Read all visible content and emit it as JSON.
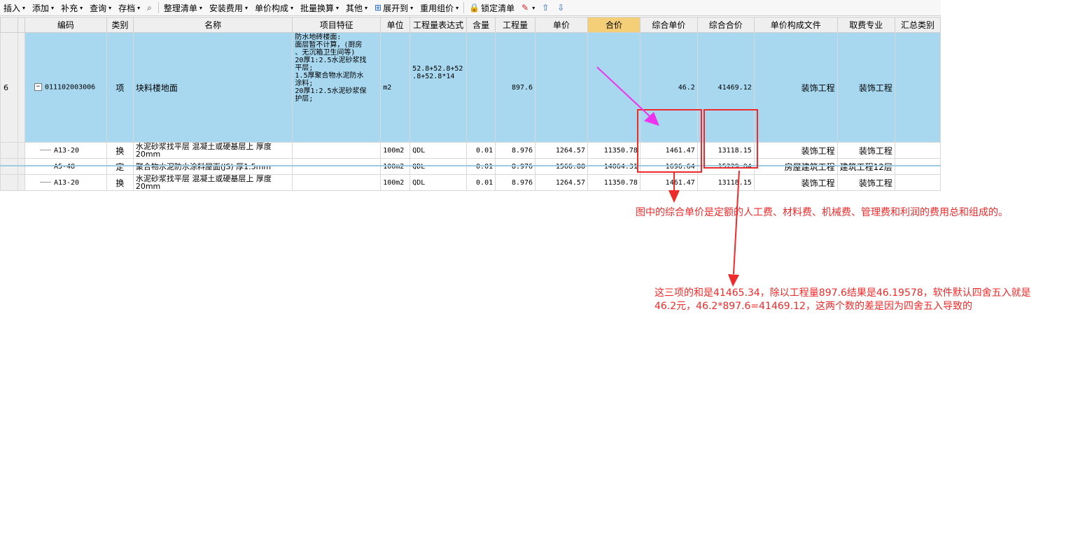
{
  "toolbar": {
    "items": [
      {
        "label": "插入",
        "icon": "",
        "dropdown": true
      },
      {
        "label": "添加",
        "icon": "",
        "dropdown": true
      },
      {
        "label": "补充",
        "icon": "",
        "dropdown": true
      },
      {
        "label": "查询",
        "icon": "",
        "dropdown": true
      },
      {
        "label": "存档",
        "icon": "",
        "dropdown": true
      },
      {
        "label": "",
        "icon": "binoculars-icon",
        "dropdown": false
      },
      {
        "label": "整理清单",
        "icon": "",
        "dropdown": true
      },
      {
        "label": "安装费用",
        "icon": "",
        "dropdown": true
      },
      {
        "label": "单价构成",
        "icon": "",
        "dropdown": true
      },
      {
        "label": "批量换算",
        "icon": "",
        "dropdown": true
      },
      {
        "label": "其他",
        "icon": "",
        "dropdown": true
      },
      {
        "label": "展开到",
        "icon": "expand-tree-icon",
        "dropdown": true
      },
      {
        "label": "重用组价",
        "icon": "",
        "dropdown": true
      },
      {
        "label": "锁定清单",
        "icon": "lock-icon",
        "dropdown": false
      },
      {
        "label": "",
        "icon": "paint-bucket-icon",
        "dropdown": true
      },
      {
        "label": "",
        "icon": "arrow-up-icon",
        "dropdown": false
      },
      {
        "label": "",
        "icon": "arrow-down-icon",
        "dropdown": false
      }
    ]
  },
  "columns": [
    "编码",
    "类别",
    "名称",
    "项目特征",
    "单位",
    "工程量表达式",
    "含量",
    "工程量",
    "单价",
    "合价",
    "综合单价",
    "综合合价",
    "单价构成文件",
    "取费专业",
    "汇总类别"
  ],
  "main_row": {
    "row_number": "6",
    "expand_symbol": "−",
    "code": "011102003006",
    "category": "项",
    "name": "块料楼地面",
    "feature_lines": [
      "防水地砖楼面:",
      "面层暂不计算，(厨房",
      "、无沉箱卫生间等)",
      "20厚1:2.5水泥砂浆找",
      "平层;",
      "1.5厚聚合物水泥防水",
      "涂料;",
      "20厚1:2.5水泥砂浆保",
      "护层;"
    ],
    "unit": "m2",
    "expression_lines": [
      "52.8+52.8+52",
      ".8+52.8*14"
    ],
    "content": "",
    "quantity": "897.6",
    "unit_price": "",
    "total_price": "",
    "comp_unit_price": "46.2",
    "comp_total_price": "41469.12",
    "price_file": "装饰工程",
    "fee_specialty": "装饰工程",
    "summary_type": ""
  },
  "sub_rows": [
    {
      "code": "A13-20",
      "category": "换",
      "name": "水泥砂浆找平层 混凝土或硬基层上 厚度20mm",
      "unit": "100m2",
      "expression": "QDL",
      "content": "0.01",
      "quantity": "8.976",
      "unit_price": "1264.57",
      "total_price": "11350.78",
      "comp_unit_price": "1461.47",
      "comp_total_price": "13118.15",
      "price_file": "装饰工程",
      "fee_specialty": "装饰工程"
    },
    {
      "code": "A5-48",
      "category": "定",
      "name": "聚合物水泥防水涂料屋面(JS) 厚1.5mm",
      "unit": "100m2",
      "expression": "QDL",
      "content": "0.01",
      "quantity": "8.976",
      "unit_price": "1566.88",
      "total_price": "14064.31",
      "comp_unit_price": "1696.64",
      "comp_total_price": "15229.04",
      "price_file": "房屋建筑工程",
      "fee_specialty": "建筑工程12层"
    },
    {
      "code": "A13-20",
      "category": "换",
      "name": "水泥砂浆找平层 混凝土或硬基层上 厚度20mm",
      "unit": "100m2",
      "expression": "QDL",
      "content": "0.01",
      "quantity": "8.976",
      "unit_price": "1264.57",
      "total_price": "11350.78",
      "comp_unit_price": "1461.47",
      "comp_total_price": "13118.15",
      "price_file": "装饰工程",
      "fee_specialty": "装饰工程"
    }
  ],
  "annotations": {
    "note1": "图中的综合单价是定额的人工费、材料费、机械费、管理费和利润的费用总和组成的。",
    "note2_line1": "这三项的和是41465.34，除以工程量897.6结果是46.19578，软件默认四舍五入就是",
    "note2_line2": "46.2元，46.2*897.6=41469.12，这两个数的差是因为四舍五入导致的"
  },
  "colors": {
    "highlight_row": "#a8d8f0",
    "header_active": "#f4cf78",
    "annotation_red": "#ee2a2a",
    "arrow_magenta": "#ee33ee"
  }
}
